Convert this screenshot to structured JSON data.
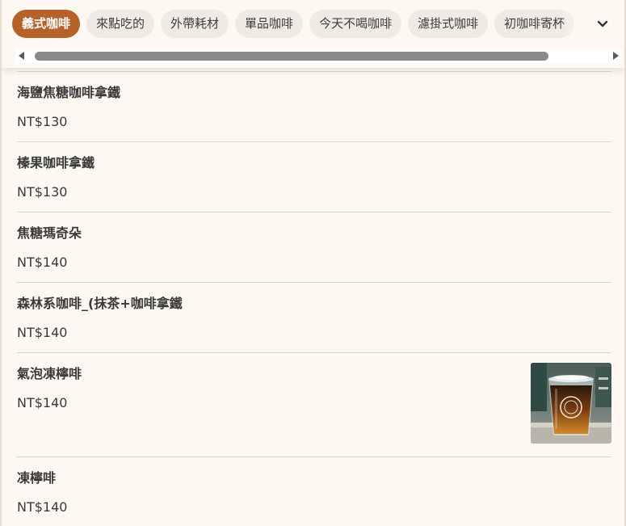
{
  "categories": {
    "tabs": [
      {
        "label": "義式咖啡",
        "active": true
      },
      {
        "label": "來點吃的",
        "active": false
      },
      {
        "label": "外帶耗材",
        "active": false
      },
      {
        "label": "單品咖啡",
        "active": false
      },
      {
        "label": "今天不喝咖啡",
        "active": false
      },
      {
        "label": "濾掛式咖啡",
        "active": false
      },
      {
        "label": "初咖啡寄杯",
        "active": false
      }
    ],
    "expand_icon": "chevron-down-icon"
  },
  "menu": {
    "items": [
      {
        "name": "海鹽焦糖咖啡拿鐵",
        "price": "NT$130"
      },
      {
        "name": "榛果咖啡拿鐵",
        "price": "NT$130"
      },
      {
        "name": "焦糖瑪奇朵",
        "price": "NT$140"
      },
      {
        "name": "森林系咖啡_(抹茶+咖啡拿鐵",
        "price": "NT$140"
      },
      {
        "name": "氣泡凍檸啡",
        "price": "NT$140"
      },
      {
        "name": "凍檸啡",
        "price": "NT$140"
      }
    ]
  },
  "colors": {
    "background": "#fdf9f2",
    "accent": "#b5612a",
    "tab_bg": "#efebe4",
    "divider": "#ddd6cb"
  }
}
